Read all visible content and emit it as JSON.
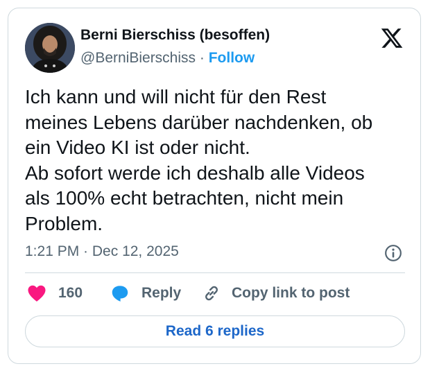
{
  "tweet": {
    "author_name": "Berni Bierschiss (besoffen)",
    "handle": "@BerniBierschiss",
    "separator": " · ",
    "follow_label": "Follow",
    "text": "Ich kann und will nicht für den Rest\nmeines Lebens darüber nachdenken, ob\nein Video KI ist oder nicht.\nAb sofort werde ich deshalb alle Videos\nals 100% echt betrachten, nicht mein\nProblem.",
    "time": "1:21 PM",
    "date": "Dec 12, 2025"
  },
  "actions": {
    "like_count": "160",
    "reply_label": "Reply",
    "copy_label": "Copy link to post"
  },
  "read_replies_label": "Read 6 replies",
  "icons": {
    "logo": "x-logo-icon",
    "info": "info-icon",
    "like": "heart-icon",
    "reply": "speech-bubble-icon",
    "copy": "link-icon"
  },
  "colors": {
    "accent": "#1d9bf0",
    "like": "#f91880",
    "reply_icon": "#1d9bf0",
    "muted": "#536471"
  }
}
